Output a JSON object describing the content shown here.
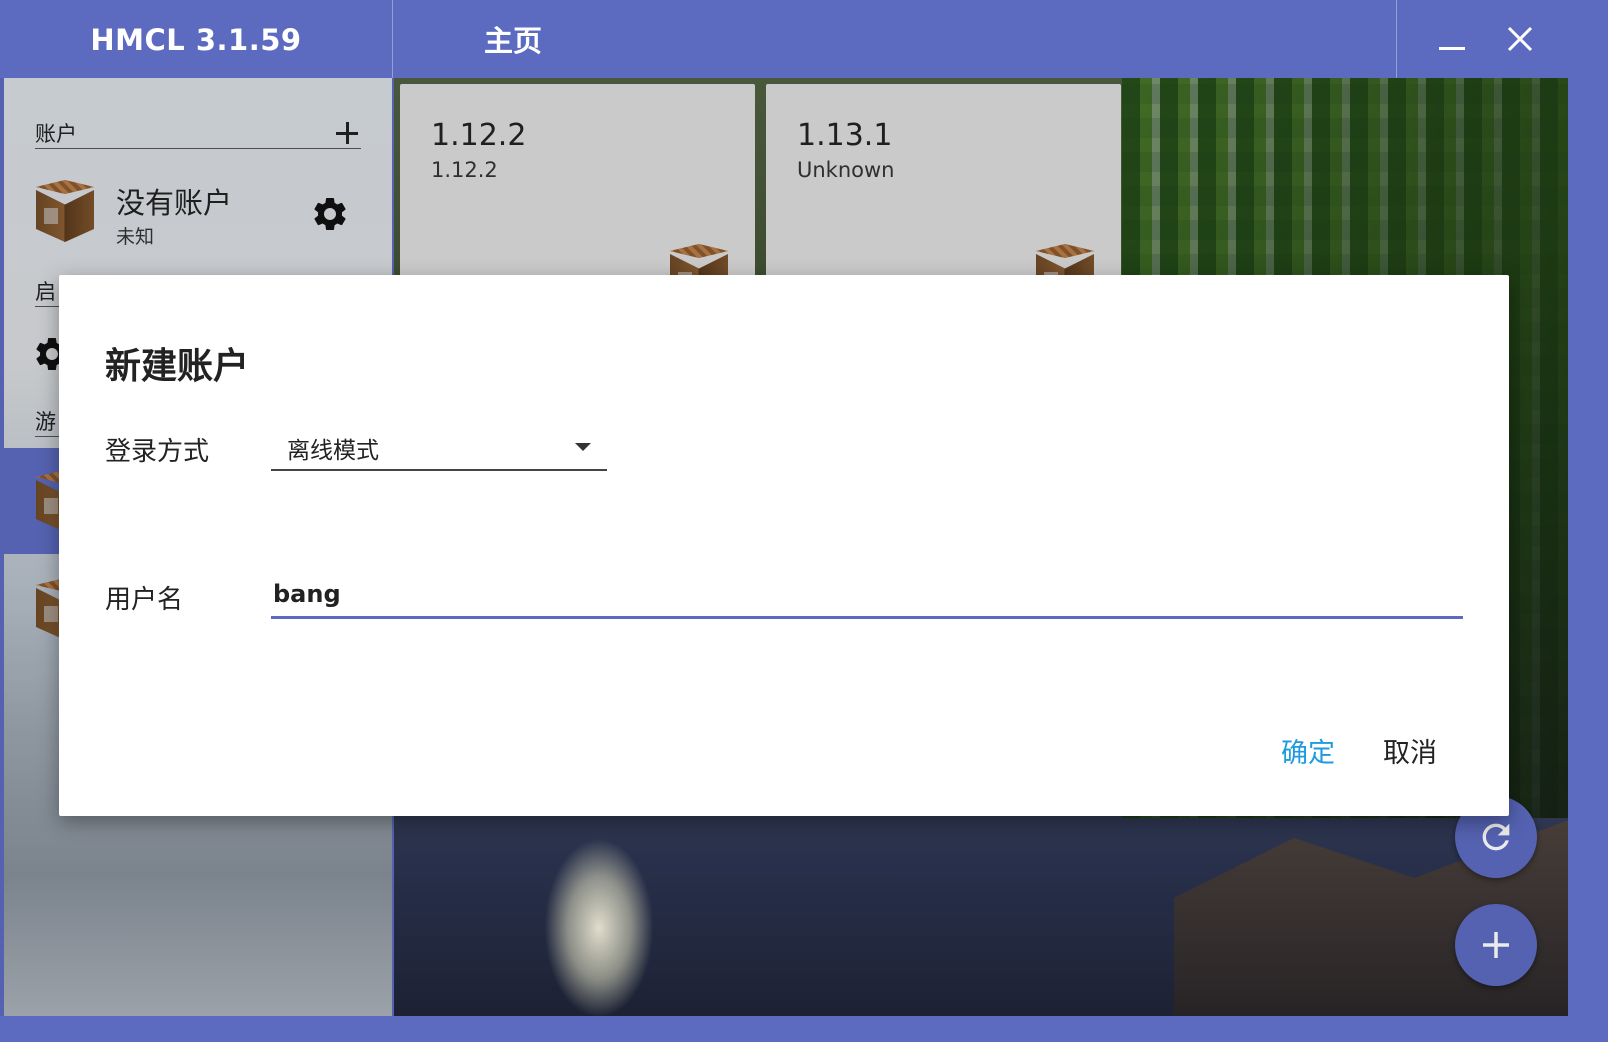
{
  "titlebar": {
    "app_title": "HMCL 3.1.59",
    "page_title": "主页",
    "minimize_icon": "minimize-icon",
    "close_icon": "close-icon"
  },
  "sidebar": {
    "accounts_header": "账户",
    "account_name": "没有账户",
    "account_type": "未知",
    "launch_header_partial": "启",
    "games_header_partial": "游"
  },
  "versions": [
    {
      "title": "1.12.2",
      "subtitle": "1.12.2"
    },
    {
      "title": "1.13.1",
      "subtitle": "Unknown"
    }
  ],
  "dialog": {
    "title": "新建账户",
    "login_method_label": "登录方式",
    "login_method_value": "离线模式",
    "username_label": "用户名",
    "username_value": "bang",
    "ok_label": "确定",
    "cancel_label": "取消"
  },
  "colors": {
    "accent": "#5c6bc0",
    "ok_button": "#1e9be0"
  }
}
